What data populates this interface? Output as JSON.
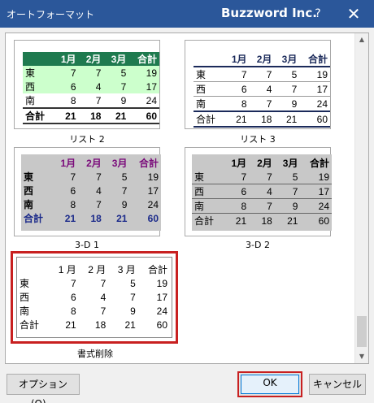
{
  "window": {
    "title": "オートフォーマット",
    "app": "Buzzword Inc.",
    "help": "?",
    "close": "✕"
  },
  "samples": {
    "header": [
      "",
      "1月",
      "2月",
      "3月",
      "合計"
    ],
    "rows": [
      [
        "東",
        "7",
        "7",
        "5",
        "19"
      ],
      [
        "西",
        "6",
        "4",
        "7",
        "17"
      ],
      [
        "南",
        "8",
        "7",
        "9",
        "24"
      ]
    ],
    "total": [
      "合計",
      "21",
      "18",
      "21",
      "60"
    ],
    "plain_header": [
      "",
      "1 月",
      "2 月",
      "3 月",
      "合計"
    ]
  },
  "formats": [
    {
      "label": "リスト 2"
    },
    {
      "label": "リスト 3"
    },
    {
      "label": "3-D 1"
    },
    {
      "label": "3-D 2"
    },
    {
      "label": "書式削除"
    }
  ],
  "buttons": {
    "options": "オプション(O)...",
    "ok": "OK",
    "cancel": "キャンセル"
  },
  "scrollbar": {
    "up": "▲",
    "down": "▼"
  }
}
